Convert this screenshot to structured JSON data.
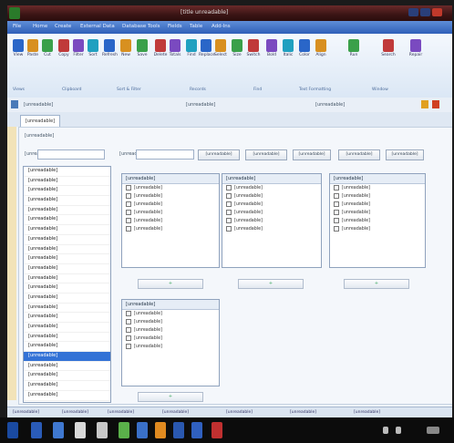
{
  "window": {
    "title": "[title unreadable]"
  },
  "menubar": {
    "items": [
      "File",
      "Home",
      "Create",
      "External Data",
      "Database Tools",
      "Fields",
      "Table",
      "Add-Ins"
    ]
  },
  "ribbon": {
    "buttons": [
      "View",
      "Paste",
      "Cut",
      "Copy",
      "Filter",
      "Sort",
      "Refresh",
      "New",
      "Save",
      "Delete",
      "Totals",
      "Find",
      "Replace",
      "Select",
      "Size",
      "Switch",
      "Bold",
      "Italic",
      "Color",
      "Align",
      "Run",
      "Search",
      "Repair"
    ],
    "groups": [
      "Views",
      "Clipboard",
      "Sort & Filter",
      "Records",
      "Find",
      "Text Formatting",
      "Window"
    ]
  },
  "formbar": {
    "left_field": "[unreadable]",
    "mid_field": "[unreadable]",
    "right_field": "[unreadable]"
  },
  "tab": {
    "label": "[unreadable]"
  },
  "panel": {
    "title": "[unreadable]",
    "search_label": "[unreadable]",
    "filter_label": "[unreadable]",
    "search_placeholder": "",
    "filter_placeholder": "",
    "buttons": [
      "[unreadable]",
      "[unreadable]",
      "[unreadable]",
      "[unreadable]",
      "[unreadable]"
    ],
    "categories": [
      "[unreadable]",
      "[unreadable]",
      "[unreadable]",
      "[unreadable]",
      "[unreadable]",
      "[unreadable]",
      "[unreadable]",
      "[unreadable]",
      "[unreadable]",
      "[unreadable]",
      "[unreadable]",
      "[unreadable]",
      "[unreadable]",
      "[unreadable]",
      "[unreadable]",
      "[unreadable]",
      "[unreadable]",
      "[unreadable]",
      "[unreadable]",
      "[unreadable]",
      "[unreadable]",
      "[unreadable]",
      "[unreadable]",
      "[unreadable]",
      "[unreadable]",
      "[unreadable]"
    ],
    "selected_index": 19,
    "boxes": [
      {
        "title": "[unreadable]",
        "rows": [
          "[unreadable]",
          "[unreadable]",
          "[unreadable]",
          "[unreadable]",
          "[unreadable]",
          "[unreadable]"
        ]
      },
      {
        "title": "[unreadable]",
        "rows": [
          "[unreadable]",
          "[unreadable]",
          "[unreadable]",
          "[unreadable]",
          "[unreadable]",
          "[unreadable]"
        ]
      },
      {
        "title": "[unreadable]",
        "rows": [
          "[unreadable]",
          "[unreadable]",
          "[unreadable]",
          "[unreadable]",
          "[unreadable]",
          "[unreadable]"
        ]
      },
      {
        "title": "[unreadable]",
        "rows": [
          "[unreadable]",
          "[unreadable]",
          "[unreadable]",
          "[unreadable]",
          "[unreadable]"
        ]
      }
    ],
    "add_button": "+"
  },
  "statusbar": {
    "items": [
      "[unreadable]",
      "[unreadable]",
      "[unreadable]",
      "[unreadable]",
      "[unreadable]",
      "[unreadable]",
      "[unreadable]"
    ]
  },
  "colors": {
    "accent": "#3372d6",
    "titlebar": "#4a1a1a",
    "menubar": "#3f6fc8"
  }
}
